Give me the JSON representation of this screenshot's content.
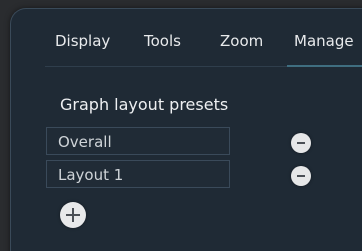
{
  "tabs": [
    {
      "label": "Display"
    },
    {
      "label": "Tools"
    },
    {
      "label": "Zoom"
    },
    {
      "label": "Manage",
      "active": true
    }
  ],
  "section": {
    "title": "Graph layout presets"
  },
  "presets": [
    {
      "label": "Overall"
    },
    {
      "label": "Layout 1"
    }
  ],
  "icons": {
    "remove": "minus-circle-icon",
    "add": "plus-circle-icon"
  },
  "colors": {
    "panel_background": "#1f2a35",
    "active_tab_indicator": "#3f6e80",
    "button_fill": "#e6e7e8"
  }
}
